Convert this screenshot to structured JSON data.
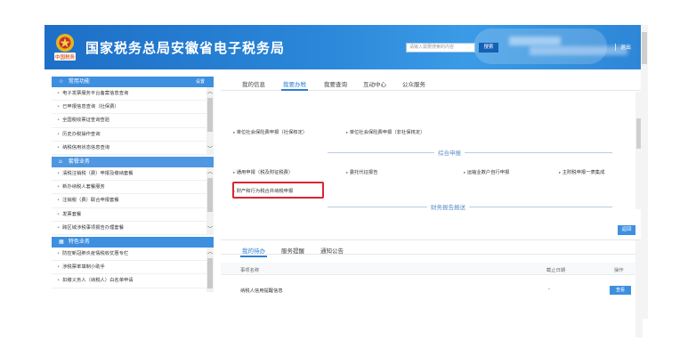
{
  "header": {
    "site_title": "国家税务总局安徽省电子税务局",
    "emblem_text": "中国税务",
    "search_placeholder": "请输入需要搜索的内容",
    "search_label": "搜索",
    "exit_label": "退出"
  },
  "sidebar": {
    "sections": [
      {
        "title": "常用功能",
        "icon": "star-icon",
        "setting_label": "设置",
        "items": [
          "电子发票服务平台备案信息查询",
          "已申报信息查询（社保费）",
          "全国税收票证查询查验",
          "历史办税操作查询",
          "纳税信用状态信息查询"
        ]
      },
      {
        "title": "套餐业务",
        "icon": "home-icon",
        "items": [
          "清税注销税（费）申报及缴纳套餐",
          "新办纳税人套餐服务",
          "注销税（费）联合申报套餐",
          "发票套餐",
          "跨区域涉税事项报告办理套餐"
        ]
      },
      {
        "title": "特色业务",
        "icon": "grid-icon",
        "items": [
          "防控新冠肺炎疫情税收优惠专栏",
          "涉税票率填制小助手",
          "扣缴义务人（纳税人）白名单申请"
        ]
      }
    ]
  },
  "main": {
    "tabs": [
      "我的信息",
      "我要办税",
      "我要查询",
      "互动中心",
      "公众服务"
    ],
    "active_tab": "我要办税",
    "links_top": [
      "单位社会保险费申报（社保核定）",
      "单位社会保险费申报（非社保核定）"
    ],
    "section_comprehensive": "综合申报",
    "links_comprehensive": [
      "通用申报（税及附征税费）",
      "委托代征报告",
      "运输业数户自行申报",
      "主附税申报一表集成"
    ],
    "highlighted_link": "财产和行为税合并纳税申报",
    "section_financial": "财务报告报送",
    "back_label": "返回"
  },
  "tasks": {
    "tabs": [
      "我的待办",
      "服务提醒",
      "通知公告"
    ],
    "active_tab": "我的待办",
    "columns": [
      "事项名称",
      "截止日期",
      "操作"
    ],
    "rows": [
      {
        "name": "纳税人信用提醒信息",
        "deadline": "-",
        "action": "查看"
      }
    ]
  },
  "colors": {
    "header_blue": "#2a86d8",
    "accent_blue": "#2d7fd3",
    "highlight_red": "#d9262f"
  }
}
